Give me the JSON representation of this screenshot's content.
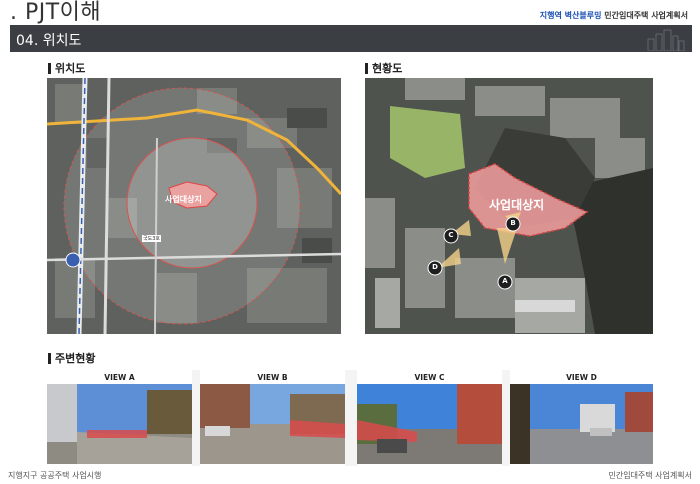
{
  "header": {
    "title": ". PJT이해",
    "project_highlight": "지행역 벽산블루밍",
    "project_rest": " 민간임대주택 사업계획서"
  },
  "section": {
    "title": "04. 위치도"
  },
  "location_map": {
    "heading": "위치도",
    "site_label": "사업대상지",
    "road_tag": "국도3호"
  },
  "status_map": {
    "heading": "현황도",
    "site_label": "사업대상지",
    "markers": [
      "A",
      "B",
      "C",
      "D"
    ]
  },
  "surroundings": {
    "heading": "주변현황",
    "views": [
      {
        "label": "VIEW A"
      },
      {
        "label": "VIEW B"
      },
      {
        "label": "VIEW C"
      },
      {
        "label": "VIEW D"
      }
    ]
  },
  "footer": {
    "left": "지행지구 공공주택 사업시행",
    "right": "민간임대주택 사업계획서"
  },
  "colors": {
    "section_band": "#3b3e43",
    "highlight_blue": "#1b4fb5",
    "site_red": "#e04545",
    "road_yellow": "#f0b43a"
  }
}
